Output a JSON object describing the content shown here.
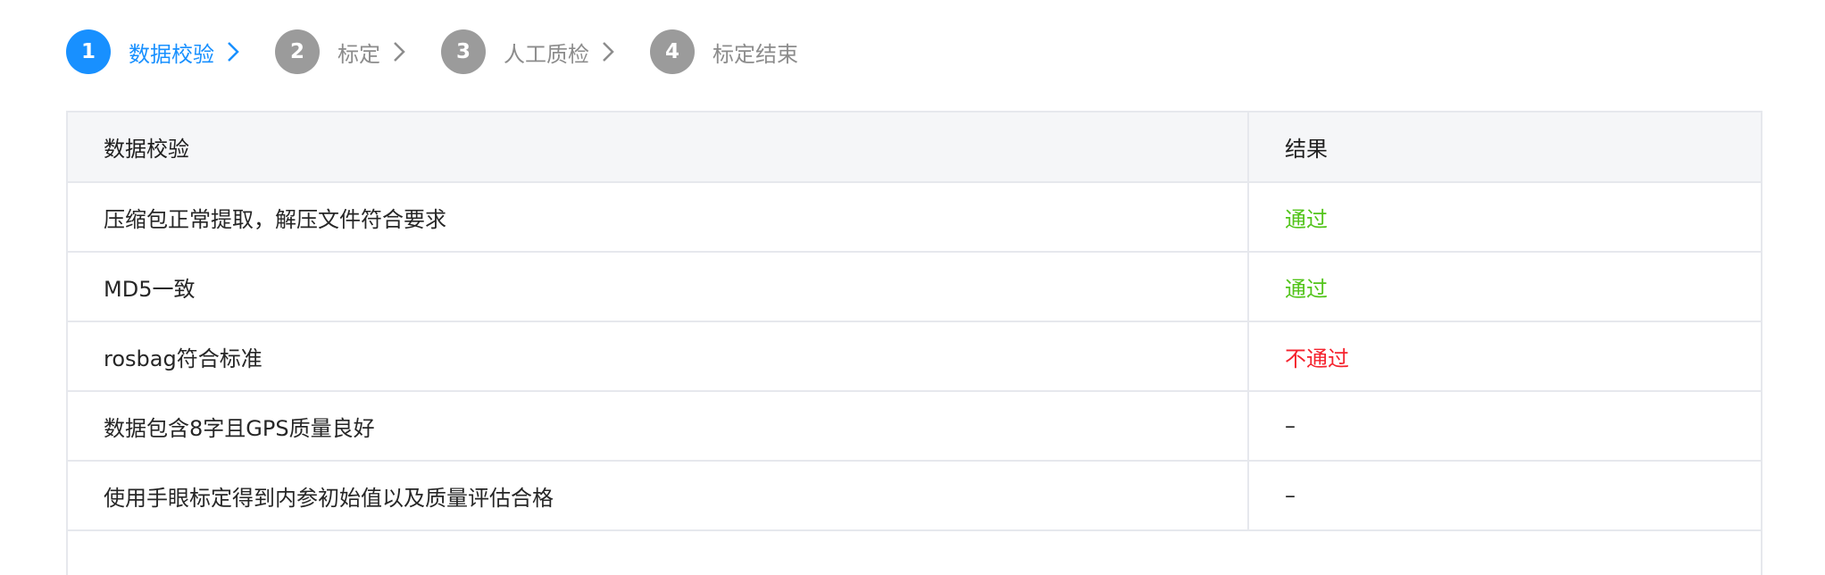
{
  "steps": [
    {
      "number": "1",
      "label": "数据校验",
      "active": true
    },
    {
      "number": "2",
      "label": "标定",
      "active": false
    },
    {
      "number": "3",
      "label": "人工质检",
      "active": false
    },
    {
      "number": "4",
      "label": "标定结束",
      "active": false
    }
  ],
  "table": {
    "headers": {
      "check": "数据校验",
      "result": "结果"
    },
    "rows": [
      {
        "check": "压缩包正常提取，解压文件符合要求",
        "result": "通过",
        "status": "pass"
      },
      {
        "check": "MD5一致",
        "result": "通过",
        "status": "pass"
      },
      {
        "check": "rosbag符合标准",
        "result": "不通过",
        "status": "fail"
      },
      {
        "check": "数据包含8字且GPS质量良好",
        "result": "–",
        "status": "none"
      },
      {
        "check": "使用手眼标定得到内参初始值以及质量评估合格",
        "result": "–",
        "status": "none"
      }
    ]
  },
  "colors": {
    "active": "#1890ff",
    "inactive": "#9b9b9b",
    "pass": "#52c41a",
    "fail": "#f5222d",
    "border": "#e6e8ed",
    "header_bg": "#f5f6f8"
  },
  "icons": {
    "step_separator": "chevron-right-icon"
  }
}
